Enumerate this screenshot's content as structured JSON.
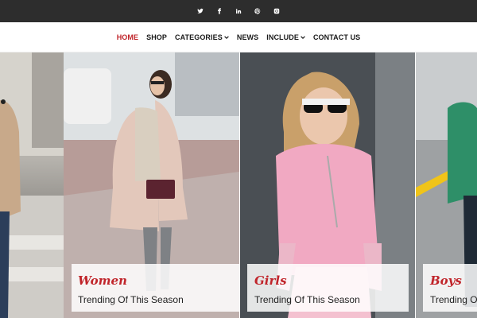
{
  "social": [
    {
      "name": "twitter-icon"
    },
    {
      "name": "facebook-icon"
    },
    {
      "name": "linkedin-icon"
    },
    {
      "name": "pinterest-icon"
    },
    {
      "name": "instagram-icon"
    }
  ],
  "nav": {
    "items": [
      {
        "label": "HOME",
        "active": true
      },
      {
        "label": "SHOP"
      },
      {
        "label": "CATEGORIES",
        "dropdown": true
      },
      {
        "label": "NEWS"
      },
      {
        "label": "INCLUDE",
        "dropdown": true
      },
      {
        "label": "CONTACT US"
      }
    ]
  },
  "slides": [
    {
      "title": "Women",
      "subtitle": "Trending Of This Season"
    },
    {
      "title": "Girls",
      "subtitle": "Trending Of This Season"
    },
    {
      "title": "Boys",
      "subtitle": "Trending Of This Season"
    }
  ],
  "colors": {
    "accent": "#c0242a",
    "topbar": "#2d2d2d"
  }
}
